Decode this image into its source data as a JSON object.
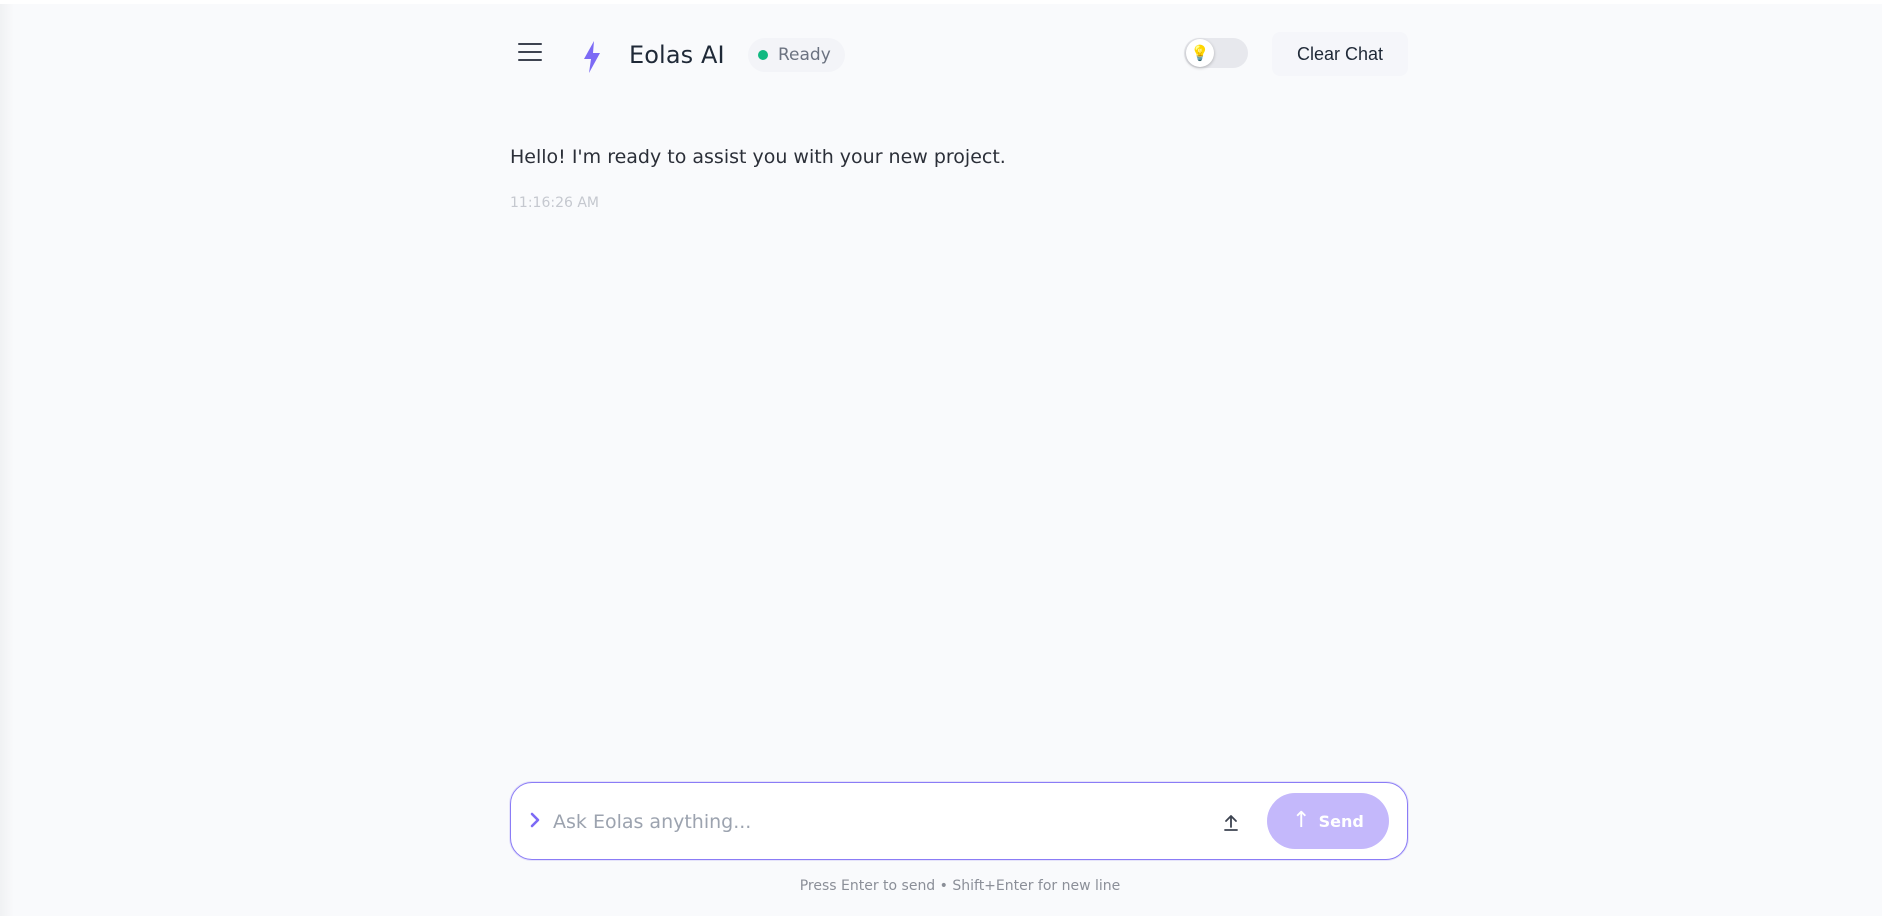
{
  "header": {
    "menu_icon": "hamburger-menu-icon",
    "logo_icon": "lightning-bolt-icon",
    "brand": "Eolas AI",
    "status": {
      "label": "Ready",
      "color": "#10b981"
    },
    "theme_toggle_icon": "lightbulb-icon",
    "clear_label": "Clear Chat"
  },
  "messages": [
    {
      "text": "Hello! I'm ready to assist you with your new project.",
      "time": "11:16:26 AM"
    }
  ],
  "composer": {
    "prompt_icon": "chevron-right-icon",
    "placeholder": "Ask Eolas anything...",
    "upload_icon": "upload-icon",
    "send_label": "Send",
    "send_icon": "arrow-up-icon",
    "hint": "Press Enter to send • Shift+Enter for new line"
  },
  "colors": {
    "accent": "#7c6af5",
    "send_button": "#c4b8fb",
    "background": "#f9fafc"
  }
}
